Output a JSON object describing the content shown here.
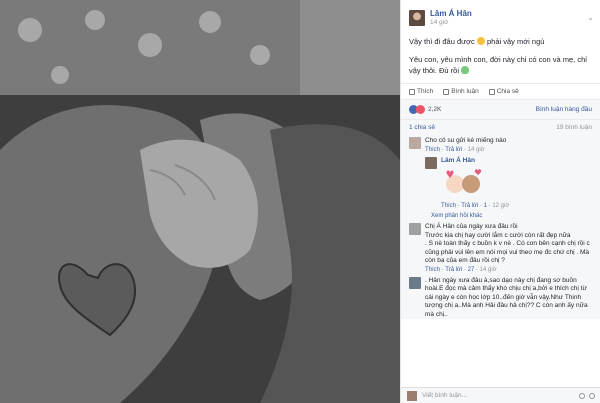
{
  "post": {
    "author": "Lâm Á Hân",
    "time": "14 giờ",
    "line1": "Vậy thì đi đâu được",
    "line1b": "phải vậy mới ngủ",
    "line2": "Yêu con, yêu mình con, đời này chỉ có con và mẹ, chỉ vậy thôi. Đủ rồi"
  },
  "actions": {
    "like": "Thích",
    "comment": "Bình luận",
    "share": "Chia sẻ"
  },
  "stats": {
    "reactions": "2,2K",
    "sort": "Bình luận hàng đầu"
  },
  "shares": {
    "count": "1 chia sẻ",
    "comments": "19 bình luận"
  },
  "comments": [
    {
      "text": "Cho cô su gửi ké miếng nào",
      "like": "Thích",
      "reply": "Trả lời",
      "time": "14 giờ"
    },
    {
      "name": "Lâm Á Hân",
      "like": "Thích",
      "reply": "Trả lời",
      "count": "1",
      "time": "12 giờ",
      "replies": "Xem phản hồi khác"
    },
    {
      "text": "Chị Á Hân của ngày xưa đâu rồi\nTrước kia chị hay cười lắm c cười còn rất đẹp nữa\n. S nè toàn thấy c buồn k v nè . Có con bên cạnh chị rồi c cũng phải vui lên em nói mọi vui theo mẹ đc chứ chị . Mà còn ba của em đâu rồi chị ?",
      "like": "Thích",
      "reply": "Trả lời",
      "count": "27",
      "time": "14 giờ"
    },
    {
      "text": ". Hân ngày xưa đâu à,sao dạo này chị đang sơ buồn hoài.E đọc mà cảm thấy khó chịu chị a,bởi e thích chị từ cái ngày e còn học lớp 10..đến giờ vẫn vậy.Như Thinh tượng chị a..Mà anh Hải đâu hả chị?? C còn anh ấy nữa mà chị.."
    }
  ],
  "writebar": {
    "placeholder": "Viết bình luận..."
  }
}
